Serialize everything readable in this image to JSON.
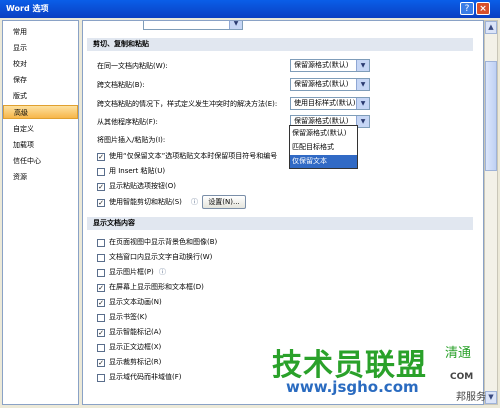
{
  "window": {
    "title": "Word 选项",
    "help_glyph": "?",
    "close_glyph": "×"
  },
  "sidebar": {
    "items": [
      {
        "label": "常用"
      },
      {
        "label": "显示"
      },
      {
        "label": "校对"
      },
      {
        "label": "保存"
      },
      {
        "label": "版式"
      },
      {
        "label": "高级",
        "selected": true
      },
      {
        "label": "自定义"
      },
      {
        "label": "加载项"
      },
      {
        "label": "信任中心"
      },
      {
        "label": "资源"
      }
    ]
  },
  "section_cut": {
    "header": "剪切、复制和粘贴",
    "same_doc_label": "在同一文档内粘贴(W):",
    "same_doc_value": "保留源格式(默认)",
    "cross_doc_label": "跨文档粘贴(B):",
    "cross_doc_value": "保留源格式(默认)",
    "conflict_label": "跨文档粘贴的情况下，样式定义发生冲突时的解决方法(E):",
    "conflict_value": "使用目标样式(默认)",
    "other_prog_label": "从其他程序粘贴(F):",
    "other_prog_value": "保留源格式(默认)",
    "insert_pic_label": "将图片插入/粘贴为(I):",
    "keep_text_label": "使用“仅保留文本”选项粘贴文本时保留项目符号和编号",
    "insert_key_label": "用 Insert 粘贴(U)",
    "show_paste_btn_label": "显示粘贴选项按钮(O)",
    "smart_cut_label": "使用智能剪切和粘贴(S)",
    "settings_button": "设置(N)...",
    "dropdown_options": [
      "保留源格式(默认)",
      "匹配目标格式",
      "仅保留文本"
    ],
    "highlighted_option": "仅保留文本"
  },
  "section_display": {
    "header": "显示文档内容",
    "items": [
      {
        "label": "在页面视图中显示背景色和图像(B)",
        "checked": false
      },
      {
        "label": "文档窗口内显示文字自动换行(W)",
        "checked": false
      },
      {
        "label": "显示图片框(P)",
        "checked": false
      },
      {
        "label": "在屏幕上显示图形和文本框(D)",
        "checked": true
      },
      {
        "label": "显示文本动画(N)",
        "checked": true
      },
      {
        "label": "显示书签(K)",
        "checked": false
      },
      {
        "label": "显示智能标记(A)",
        "checked": true
      },
      {
        "label": "显示正文边框(X)",
        "checked": false
      },
      {
        "label": "显示裁剪标记(R)",
        "checked": true
      },
      {
        "label": "显示域代码而非域值(F)",
        "checked": false
      }
    ]
  },
  "watermark": {
    "brand": "技术员联盟",
    "site": "www.jsgho.com",
    "tag": "清通",
    "com": "COM",
    "service": "邦服务"
  },
  "colors": {
    "titlebar": "#0a4fd6",
    "selection": "#f7b64a",
    "highlight": "#316ac5",
    "watermark_green": "#2aa12a"
  }
}
